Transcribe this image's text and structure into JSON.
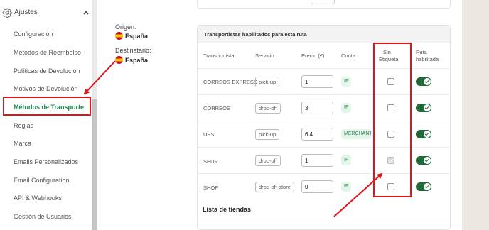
{
  "sidebar": {
    "title": "Ajustes",
    "items": [
      {
        "label": "Configuración"
      },
      {
        "label": "Métodos de Reembolso"
      },
      {
        "label": "Políticas de Devolución"
      },
      {
        "label": "Motivos de Devolución"
      },
      {
        "label": "Métodos de Transporte",
        "active": true
      },
      {
        "label": "Reglas"
      },
      {
        "label": "Marca"
      },
      {
        "label": "Emails Personalizados"
      },
      {
        "label": "Email Configuration"
      },
      {
        "label": "API & Webhooks"
      },
      {
        "label": "Gestión de Usuarios"
      }
    ]
  },
  "route": {
    "origin_label": "Origen:",
    "origin_country": "España",
    "destination_label": "Destinatario:",
    "destination_country": "España"
  },
  "carriers_card": {
    "title": "Transportistas habilitados para esta ruta",
    "headers": {
      "carrier": "Transportista",
      "service": "Servicio",
      "price": "Precio (€)",
      "account": "Conta",
      "no_label_line1": "Sin",
      "no_label_line2": "Etiqueta",
      "route_enabled_line1": "Ruta",
      "route_enabled_line2": "habilitada"
    },
    "rows": [
      {
        "carrier": "CORREOS-EXPRESS",
        "service": "pick-up",
        "price": "1",
        "account": "IF",
        "no_label": false,
        "enabled": true
      },
      {
        "carrier": "CORREOS",
        "service": "drop-off",
        "price": "3",
        "account": "IF",
        "no_label": false,
        "enabled": true
      },
      {
        "carrier": "UPS",
        "service": "pick-up",
        "price": "6.4",
        "account": "MERCHANT",
        "no_label": false,
        "enabled": true
      },
      {
        "carrier": "SEUR",
        "service": "drop-off",
        "price": "1",
        "account": "IF",
        "no_label": true,
        "enabled": true
      },
      {
        "carrier": "SHOP",
        "service": "drop-off-store",
        "price": "0",
        "account": "IF",
        "no_label": false,
        "enabled": true
      }
    ]
  },
  "stores_section": {
    "title": "Lista de tiendas"
  },
  "colors": {
    "accent_green": "#1e6b3a",
    "annotation_red": "#e0141b"
  },
  "icons": {
    "settings": "gear-icon",
    "collapse": "chevron-up-icon"
  }
}
